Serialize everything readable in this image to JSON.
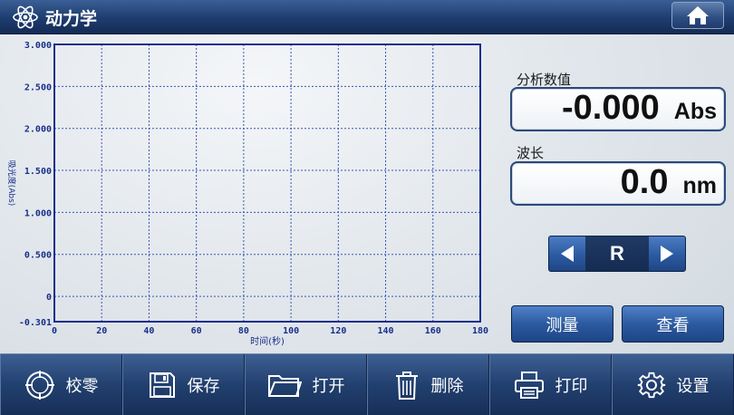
{
  "header": {
    "title": "动力学",
    "app_icon": "atom-icon",
    "home_icon": "home-icon"
  },
  "colors": {
    "accent": "#2c5aa0",
    "chart_axis": "#1a2f8a",
    "chart_grid": "#3a55b0"
  },
  "chart_data": {
    "type": "line",
    "xlabel": "时间(秒)",
    "ylabel": "吸光度(Abs)",
    "xlim": [
      0,
      180
    ],
    "ylim": [
      -0.301,
      3.0
    ],
    "x_ticks": [
      "0",
      "20",
      "40",
      "60",
      "80",
      "100",
      "120",
      "140",
      "160",
      "180"
    ],
    "y_ticks": [
      "3.000",
      "2.500",
      "2.000",
      "1.500",
      "1.000",
      "0.500",
      "0",
      "-0.301"
    ],
    "grid": true,
    "series": []
  },
  "panel": {
    "analysis_label": "分析数值",
    "analysis_value": "-0.000",
    "analysis_unit": "Abs",
    "wavelength_label": "波长",
    "wavelength_value": "0.0",
    "wavelength_unit": "nm",
    "selector_value": "R",
    "measure_label": "测量",
    "view_label": "查看"
  },
  "toolbar": {
    "zero_label": "校零",
    "save_label": "保存",
    "open_label": "打开",
    "delete_label": "删除",
    "print_label": "打印",
    "settings_label": "设置"
  }
}
